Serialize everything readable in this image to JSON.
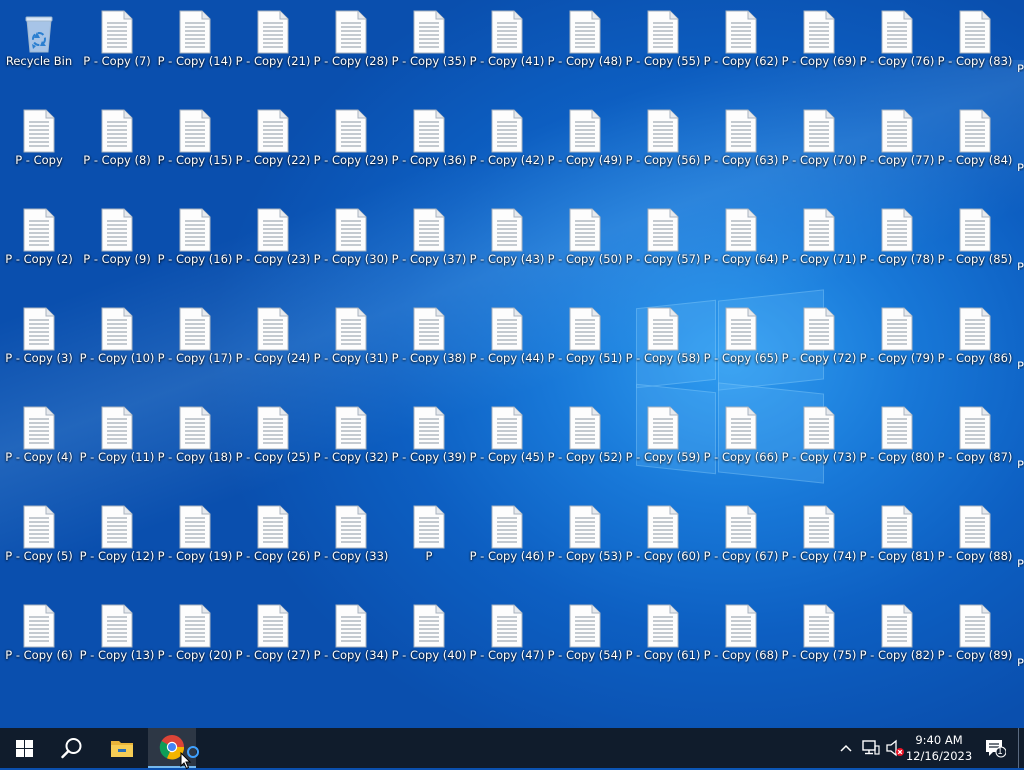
{
  "desktop": {
    "recycle_bin_label": "Recycle Bin",
    "columns": [
      [
        "P - Copy",
        "P - Copy (2)",
        "P - Copy (3)",
        "P - Copy (4)",
        "P - Copy (5)",
        "P - Copy (6)"
      ],
      [
        "P - Copy (7)",
        "P - Copy (8)",
        "P - Copy (9)",
        "P - Copy (10)",
        "P - Copy (11)",
        "P - Copy (12)",
        "P - Copy (13)"
      ],
      [
        "P - Copy (14)",
        "P - Copy (15)",
        "P - Copy (16)",
        "P - Copy (17)",
        "P - Copy (18)",
        "P - Copy (19)",
        "P - Copy (20)"
      ],
      [
        "P - Copy (21)",
        "P - Copy (22)",
        "P - Copy (23)",
        "P - Copy (24)",
        "P - Copy (25)",
        "P - Copy (26)",
        "P - Copy (27)"
      ],
      [
        "P - Copy (28)",
        "P - Copy (29)",
        "P - Copy (30)",
        "P - Copy (31)",
        "P - Copy (32)",
        "P - Copy (33)",
        "P - Copy (34)"
      ],
      [
        "P - Copy (35)",
        "P - Copy (36)",
        "P - Copy (37)",
        "P - Copy (38)",
        "P - Copy (39)",
        "P",
        "P - Copy (40)"
      ],
      [
        "P - Copy (41)",
        "P - Copy (42)",
        "P - Copy (43)",
        "P - Copy (44)",
        "P - Copy (45)",
        "P - Copy (46)",
        "P - Copy (47)"
      ],
      [
        "P - Copy (48)",
        "P - Copy (49)",
        "P - Copy (50)",
        "P - Copy (51)",
        "P - Copy (52)",
        "P - Copy (53)",
        "P - Copy (54)"
      ],
      [
        "P - Copy (55)",
        "P - Copy (56)",
        "P - Copy (57)",
        "P - Copy (58)",
        "P - Copy (59)",
        "P - Copy (60)",
        "P - Copy (61)"
      ],
      [
        "P - Copy (62)",
        "P - Copy (63)",
        "P - Copy (64)",
        "P - Copy (65)",
        "P - Copy (66)",
        "P - Copy (67)",
        "P - Copy (68)"
      ],
      [
        "P - Copy (69)",
        "P - Copy (70)",
        "P - Copy (71)",
        "P - Copy (72)",
        "P - Copy (73)",
        "P - Copy (74)",
        "P - Copy (75)"
      ],
      [
        "P - Copy (76)",
        "P - Copy (77)",
        "P - Copy (78)",
        "P - Copy (79)",
        "P - Copy (80)",
        "P - Copy (81)",
        "P - Copy (82)"
      ],
      [
        "P - Copy (83)",
        "P - Copy (84)",
        "P - Copy (85)",
        "P - Copy (86)",
        "P - Copy (87)",
        "P - Copy (88)",
        "P - Copy (89)"
      ]
    ],
    "edge_label": "P"
  },
  "taskbar": {
    "start_icon": "windows-start-icon",
    "search_icon": "search-icon",
    "pinned": [
      {
        "name": "file-explorer-icon"
      },
      {
        "name": "chrome-icon",
        "active": true
      }
    ],
    "tray": {
      "chevron_icon": "chevron-up-icon",
      "network_icon": "network-icon",
      "volume_icon": "volume-muted-icon",
      "time": "9:40 AM",
      "date": "12/16/2023",
      "notifications_icon": "notification-icon",
      "notifications_count": "1"
    }
  },
  "colors": {
    "taskbar": "#101c2c",
    "wallpaper_accent": "#1878d8",
    "mute_badge": "#e81123"
  }
}
